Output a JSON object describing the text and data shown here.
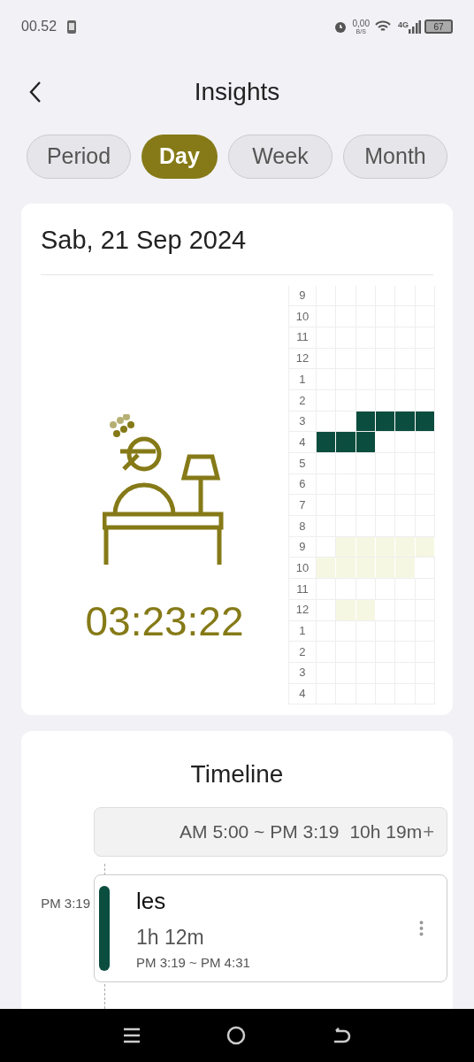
{
  "status_bar": {
    "time": "00.52",
    "net_speed": "0,00",
    "net_unit": "B/S",
    "network": "4G",
    "battery": "67"
  },
  "header": {
    "title": "Insights"
  },
  "tabs": [
    {
      "label": "Period",
      "selected": false
    },
    {
      "label": "Day",
      "selected": true
    },
    {
      "label": "Week",
      "selected": false
    },
    {
      "label": "Month",
      "selected": false
    }
  ],
  "day_card": {
    "date": "Sab, 21 Sep 2024",
    "total": "03:23:22",
    "grid": [
      {
        "label": "9",
        "cells": [
          {
            "filled": false
          },
          {
            "filled": false
          },
          {
            "filled": false
          },
          {
            "filled": false
          },
          {
            "filled": false
          },
          {
            "filled": false
          }
        ]
      },
      {
        "label": "10",
        "cells": [
          {
            "filled": false
          },
          {
            "filled": false
          },
          {
            "filled": false
          },
          {
            "filled": false
          },
          {
            "filled": false
          },
          {
            "filled": false
          }
        ]
      },
      {
        "label": "11",
        "cells": [
          {
            "filled": false
          },
          {
            "filled": false
          },
          {
            "filled": false
          },
          {
            "filled": false
          },
          {
            "filled": false
          },
          {
            "filled": false
          }
        ]
      },
      {
        "label": "12",
        "cells": [
          {
            "filled": false
          },
          {
            "filled": false
          },
          {
            "filled": false
          },
          {
            "filled": false
          },
          {
            "filled": false
          },
          {
            "filled": false
          }
        ]
      },
      {
        "label": "1",
        "cells": [
          {
            "filled": false
          },
          {
            "filled": false
          },
          {
            "filled": false
          },
          {
            "filled": false
          },
          {
            "filled": false
          },
          {
            "filled": false
          }
        ]
      },
      {
        "label": "2",
        "cells": [
          {
            "filled": false
          },
          {
            "filled": false
          },
          {
            "filled": false
          },
          {
            "filled": false
          },
          {
            "filled": false
          },
          {
            "filled": false
          }
        ]
      },
      {
        "label": "3",
        "cells": [
          {
            "filled": false
          },
          {
            "filled": false
          },
          {
            "filled": true,
            "color": "#0b4d3e"
          },
          {
            "filled": true,
            "color": "#0b4d3e"
          },
          {
            "filled": true,
            "color": "#0b4d3e"
          },
          {
            "filled": true,
            "color": "#0b4d3e"
          }
        ]
      },
      {
        "label": "4",
        "cells": [
          {
            "filled": true,
            "color": "#0b4d3e"
          },
          {
            "filled": true,
            "color": "#0b4d3e"
          },
          {
            "filled": true,
            "color": "#0b4d3e"
          },
          {
            "filled": false
          },
          {
            "filled": false
          },
          {
            "filled": false
          }
        ]
      },
      {
        "label": "5",
        "cells": [
          {
            "filled": false
          },
          {
            "filled": false
          },
          {
            "filled": false
          },
          {
            "filled": false
          },
          {
            "filled": false
          },
          {
            "filled": false
          }
        ]
      },
      {
        "label": "6",
        "cells": [
          {
            "filled": false
          },
          {
            "filled": false
          },
          {
            "filled": false
          },
          {
            "filled": false
          },
          {
            "filled": false
          },
          {
            "filled": false
          }
        ]
      },
      {
        "label": "7",
        "cells": [
          {
            "filled": false
          },
          {
            "filled": false
          },
          {
            "filled": false
          },
          {
            "filled": false
          },
          {
            "filled": false
          },
          {
            "filled": false
          }
        ]
      },
      {
        "label": "8",
        "cells": [
          {
            "filled": false
          },
          {
            "filled": false
          },
          {
            "filled": false
          },
          {
            "filled": false
          },
          {
            "filled": false
          },
          {
            "filled": false
          }
        ]
      },
      {
        "label": "9",
        "cells": [
          {
            "filled": false
          },
          {
            "filled": true,
            "color": "#f6f7e3"
          },
          {
            "filled": true,
            "color": "#f6f7e3"
          },
          {
            "filled": true,
            "color": "#f6f7e3"
          },
          {
            "filled": true,
            "color": "#f6f7e3"
          },
          {
            "filled": true,
            "color": "#f6f7e3"
          }
        ]
      },
      {
        "label": "10",
        "cells": [
          {
            "filled": true,
            "color": "#f6f7e3"
          },
          {
            "filled": true,
            "color": "#f6f7e3"
          },
          {
            "filled": true,
            "color": "#f6f7e3"
          },
          {
            "filled": true,
            "color": "#f6f7e3"
          },
          {
            "filled": true,
            "color": "#f6f7e3"
          },
          {
            "filled": false
          }
        ]
      },
      {
        "label": "11",
        "cells": [
          {
            "filled": false
          },
          {
            "filled": false
          },
          {
            "filled": false
          },
          {
            "filled": false
          },
          {
            "filled": false
          },
          {
            "filled": false
          }
        ]
      },
      {
        "label": "12",
        "cells": [
          {
            "filled": false
          },
          {
            "filled": true,
            "color": "#f6f7e3"
          },
          {
            "filled": true,
            "color": "#f6f7e3"
          },
          {
            "filled": false
          },
          {
            "filled": false
          },
          {
            "filled": false
          }
        ]
      },
      {
        "label": "1",
        "cells": [
          {
            "filled": false
          },
          {
            "filled": false
          },
          {
            "filled": false
          },
          {
            "filled": false
          },
          {
            "filled": false
          },
          {
            "filled": false
          }
        ]
      },
      {
        "label": "2",
        "cells": [
          {
            "filled": false
          },
          {
            "filled": false
          },
          {
            "filled": false
          },
          {
            "filled": false
          },
          {
            "filled": false
          },
          {
            "filled": false
          }
        ]
      },
      {
        "label": "3",
        "cells": [
          {
            "filled": false
          },
          {
            "filled": false
          },
          {
            "filled": false
          },
          {
            "filled": false
          },
          {
            "filled": false
          },
          {
            "filled": false
          }
        ]
      },
      {
        "label": "4",
        "cells": [
          {
            "filled": false
          },
          {
            "filled": false
          },
          {
            "filled": false
          },
          {
            "filled": false
          },
          {
            "filled": false
          },
          {
            "filled": false
          }
        ]
      }
    ]
  },
  "timeline": {
    "title": "Timeline",
    "gap": {
      "range": "AM 5:00 ~ PM 3:19",
      "duration": "10h 19m",
      "action": "+"
    },
    "entries": [
      {
        "time": "PM 3:19",
        "name": "les",
        "duration": "1h 12m",
        "range": "PM 3:19 ~ PM 4:31",
        "color": "#0b4d3e"
      }
    ]
  }
}
